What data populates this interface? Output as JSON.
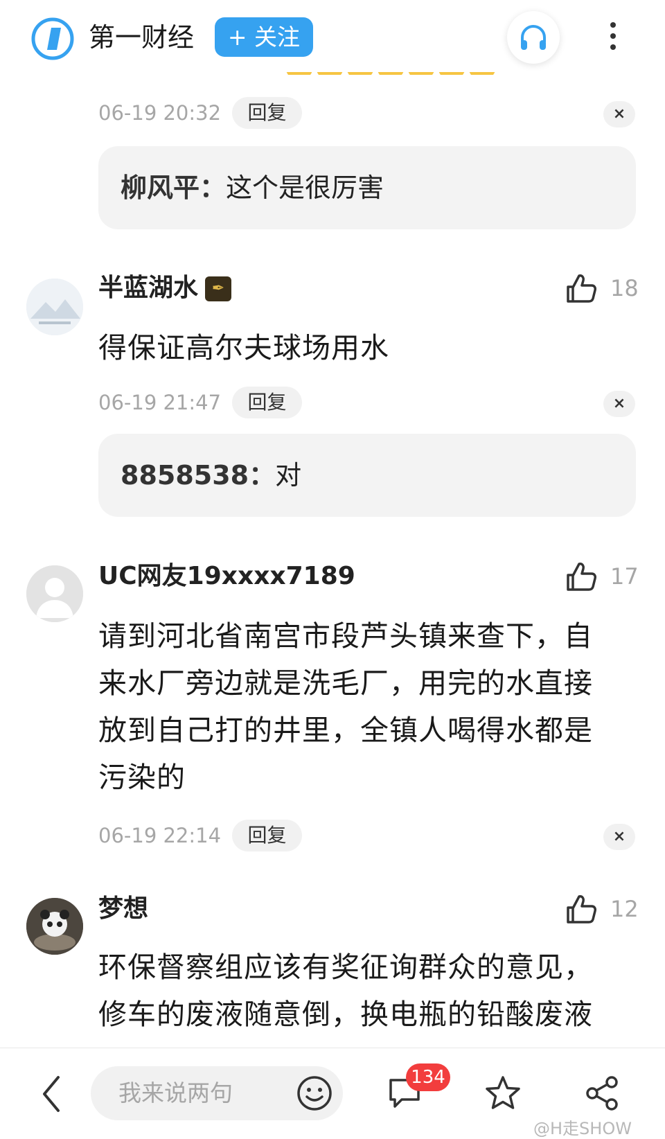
{
  "header": {
    "publisher_name": "第一财经",
    "follow_label": "+ 关注",
    "icons": [
      "publisher-logo-icon",
      "headset-icon",
      "more-vertical-icon"
    ],
    "accent_color": "#36a2f0"
  },
  "partial_comment": {
    "time": "06-19 20:32",
    "reply_label": "回复",
    "close_label": "×",
    "sub_reply": {
      "name": "柳风平：",
      "text": "这个是很厉害"
    }
  },
  "comments": [
    {
      "username": "半蓝湖水",
      "badge": "✒",
      "likes": "18",
      "text": "得保证高尔夫球场用水",
      "time": "06-19 21:47",
      "reply_label": "回复",
      "close_label": "×",
      "sub_reply": {
        "name": "8858538：",
        "text": "对"
      }
    },
    {
      "username": "UC网友19xxxx7189",
      "likes": "17",
      "text_lines": [
        "请到河北省南宫市段芦头镇来查下，自",
        "来水厂旁边就是洗毛厂，用完的水直接",
        "放到自己打的井里，全镇人喝得水都是",
        "污染的"
      ],
      "time": "06-19 22:14",
      "reply_label": "回复",
      "close_label": "×"
    },
    {
      "username": "梦想",
      "likes": "12",
      "text_lines": [
        "环保督察组应该有奖征询群众的意见，",
        "修车的废液随意倒，换电瓶的铅酸废液"
      ]
    }
  ],
  "bottom_bar": {
    "input_placeholder": "我来说两句",
    "comment_count": "134",
    "watermark": "@H走SHOW",
    "badge_color": "#f23d3d"
  }
}
